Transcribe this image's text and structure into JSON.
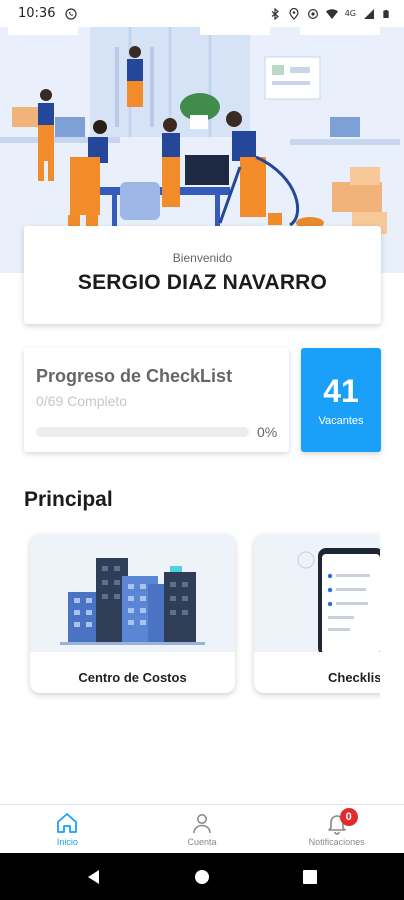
{
  "status_bar": {
    "time": "10:36",
    "network": "4G"
  },
  "welcome": {
    "label": "Bienvenido",
    "name": "SERGIO DIAZ NAVARRO"
  },
  "progress": {
    "title": "Progreso de CheckList",
    "subtitle": "0/69 Completo",
    "percent_label": "0%",
    "fraction": 0
  },
  "vacancies": {
    "count": "41",
    "label": "Vacantes"
  },
  "main_section": {
    "title": "Principal",
    "cards": [
      {
        "label": "Centro de Costos",
        "icon": "buildings-illustration"
      },
      {
        "label": "Checklis",
        "icon": "phone-checklist-illustration"
      }
    ]
  },
  "bottom_nav": {
    "items": [
      {
        "label": "Inicio",
        "icon": "home-icon",
        "active": true
      },
      {
        "label": "Cuenta",
        "icon": "user-icon",
        "active": false
      },
      {
        "label": "Notificaciones",
        "icon": "bell-icon",
        "active": false,
        "badge": "0"
      }
    ]
  },
  "colors": {
    "accent": "#1aa0f8",
    "badge": "#e32b2b",
    "hero_bg": "#e9f0fb",
    "worker_orange": "#f28c2a",
    "worker_blue": "#24479a"
  }
}
